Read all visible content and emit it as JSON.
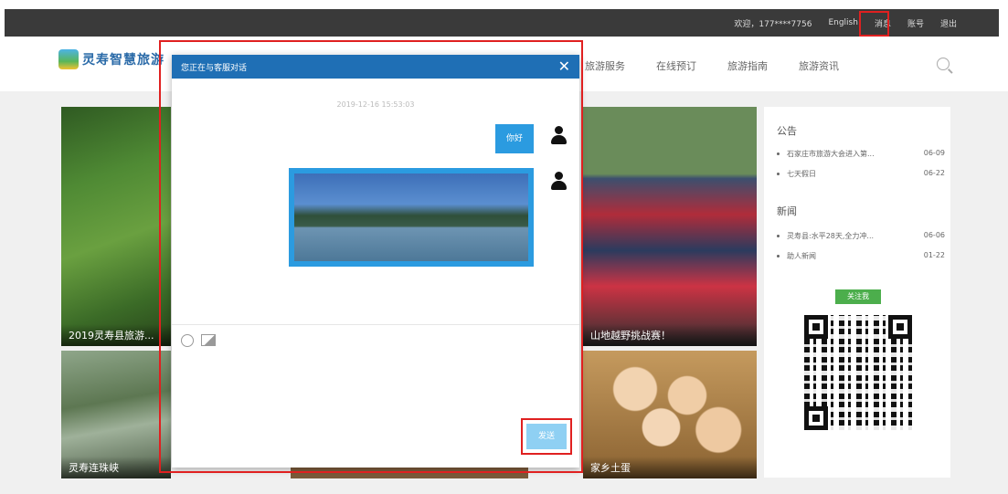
{
  "topbar": {
    "welcome": "欢迎，177****7756",
    "english": "English",
    "message": "消息",
    "account": "账号",
    "logout": "退出"
  },
  "header": {
    "logo_text": "灵寿智慧旅游",
    "nav": [
      "旅游服务",
      "在线预订",
      "旅游指南",
      "旅游资讯"
    ]
  },
  "tiles": {
    "forest_caption": "2019灵寿县旅游...",
    "rocks_caption": "灵寿连珠峡",
    "race_caption": "山地越野挑战赛！",
    "eggs_caption": "家乡土蛋"
  },
  "sidebar": {
    "notice_title": "公告",
    "notices": [
      {
        "text": "石家庄市旅游大会进入第...",
        "date": "06-09"
      },
      {
        "text": "七天假日",
        "date": "06-22"
      }
    ],
    "news_title": "新闻",
    "news": [
      {
        "text": "灵寿县:水平28天,全力冲...",
        "date": "06-06"
      },
      {
        "text": "助人新闻",
        "date": "01-22"
      }
    ],
    "follow_label": "关注我"
  },
  "dialog": {
    "title": "您正在与客服对话",
    "close": "✕",
    "timestamp": "2019-12-16 15:53:03",
    "message_text": "你好",
    "send_label": "发送"
  },
  "colors": {
    "accent": "#1f6fb5",
    "bubble": "#2b9be0",
    "highlight": "#e02020"
  }
}
